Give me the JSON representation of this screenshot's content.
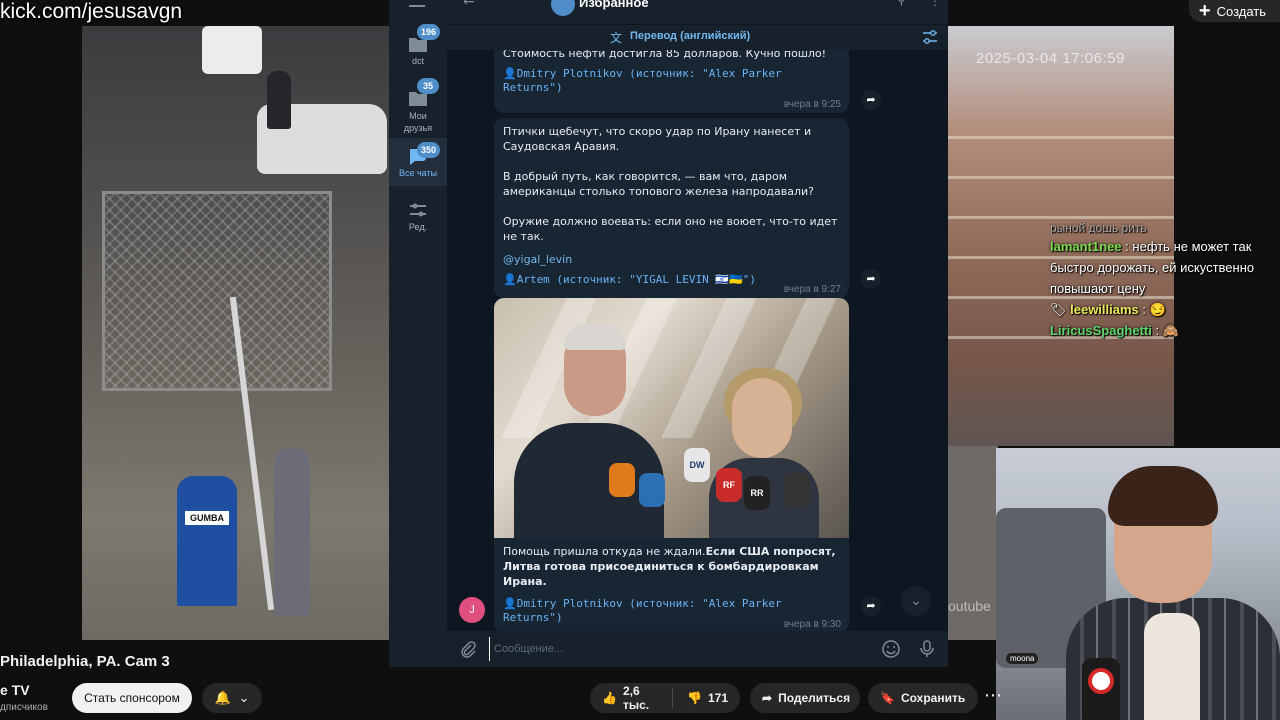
{
  "stream": {
    "kick_label": "kick.com/jesusavgn",
    "cam_timestamp": "2025-03-04 17:06:59",
    "mailbox_label": "GUMBA",
    "youtube_watermark": "outube",
    "webcam_label": "moona"
  },
  "youtube": {
    "create_label": "Создать",
    "video_title": "Philadelphia, PA. Cam 3",
    "channel_name": "e TV",
    "subscribers": "дписчиков",
    "sponsor_label": "Стать спонсором",
    "likes": "2,6 тыс.",
    "dislikes": "171",
    "share_label": "Поделиться",
    "save_label": "Сохранить"
  },
  "chat_overlay": {
    "cut_line": "рыной дошь рить",
    "messages": [
      {
        "user": "lamant1nee",
        "user_color": "#7ddc4f",
        "text": "нефть не может так быстро дорожать, ей искуственно повышают цену"
      },
      {
        "user": "leewilliams",
        "user_color": "#e9e85b",
        "text": ""
      },
      {
        "user": "LiricusSpaghetti",
        "user_color": "#5fd46b",
        "text": ""
      }
    ]
  },
  "telegram": {
    "chat_title": "Избранное",
    "nav": [
      {
        "label": "dct",
        "badge": "196",
        "icon": "folder-icon"
      },
      {
        "label": "Мои друзья",
        "badge": "35",
        "icon": "folder-icon"
      },
      {
        "label": "Все чаты",
        "badge": "350",
        "icon": "chats-icon"
      },
      {
        "label": "Ред.",
        "badge": "",
        "icon": "sliders-icon"
      }
    ],
    "translate_label": "Перевод (английский)",
    "messages": [
      {
        "text": "Стоимость нефти достигла 85 долларов. Кучно пошло!",
        "source": "👤Dmitry Plotnikov (источник: \"Alex Parker Returns\")",
        "time": "вчера в 9:25"
      },
      {
        "text": "Птички щебечут, что скоро удар по Ирану нанесет и Саудовская Аравия.\n\nВ добрый путь, как говорится, — вам что, даром американцы столько топового железа напродавали?\n\nОружие должно воевать: если оно не воюет, что-то идет не так.",
        "link": "@yigal_levin",
        "source": "👤Artem (источник: \"YIGAL LEVIN 🇮🇱🇺🇦\")",
        "time": "вчера в 9:27"
      },
      {
        "text_plain": "Помощь пришла откуда не ждали.",
        "text_bold": "Если США попросят, Литва готова присоединиться к бомбардировкам Ирана.",
        "source": "👤Dmitry Plotnikov (источник: \"Alex Parker Returns\")",
        "time": "вчера в 9:30",
        "photo_mic_logos": [
          "DW",
          "RF",
          "RR"
        ]
      }
    ],
    "avatar_letter": "J",
    "composer_placeholder": "Сообщение..."
  }
}
